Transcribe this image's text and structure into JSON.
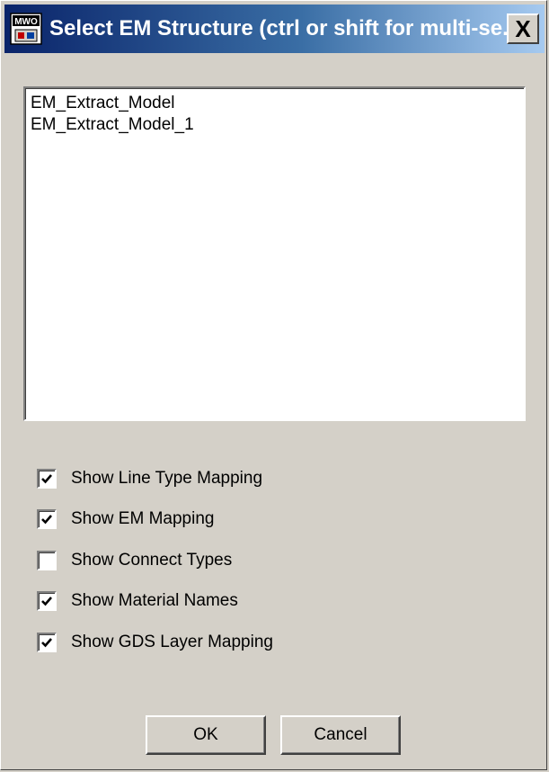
{
  "window": {
    "title": "Select EM Structure (ctrl or shift for multi-se...",
    "icon": "app-icon",
    "close_label": "X"
  },
  "structures": {
    "items": [
      "EM_Extract_Model",
      "EM_Extract_Model_1"
    ]
  },
  "options": [
    {
      "label": "Show Line Type Mapping",
      "checked": true
    },
    {
      "label": "Show EM Mapping",
      "checked": true
    },
    {
      "label": "Show Connect Types",
      "checked": false
    },
    {
      "label": "Show Material Names",
      "checked": true
    },
    {
      "label": "Show GDS Layer Mapping",
      "checked": true
    }
  ],
  "buttons": {
    "ok_label": "OK",
    "cancel_label": "Cancel"
  }
}
